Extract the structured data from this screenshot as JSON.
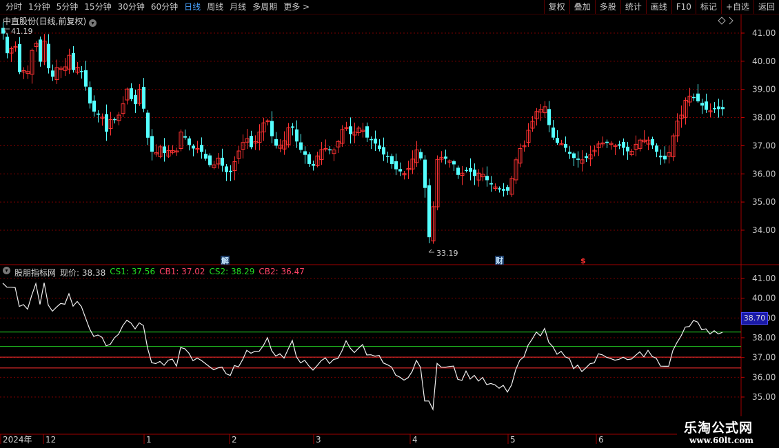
{
  "toolbar": {
    "periods": [
      "分时",
      "1分钟",
      "5分钟",
      "15分钟",
      "30分钟",
      "60分钟",
      "日线",
      "周线",
      "月线",
      "多周期",
      "更多 >"
    ],
    "active_period": "日线",
    "right_buttons": [
      "复权",
      "叠加",
      "多股",
      "统计",
      "画线",
      "F10",
      "标记",
      "+自选",
      "返回"
    ]
  },
  "main": {
    "title": "中直股份(日线,前复权)",
    "axis_ticks": [
      "41.00",
      "40.00",
      "39.00",
      "38.00",
      "37.00",
      "36.00",
      "35.00",
      "34.00"
    ],
    "high_label": "41.19",
    "low_label": "33.19",
    "markers": [
      "解",
      "财",
      "$"
    ]
  },
  "indicator": {
    "name": "股朋指标网",
    "values": [
      {
        "label": "现价: 38.38",
        "color": "#d0d0d0"
      },
      {
        "label": "CS1: 37.56",
        "color": "#22dd22"
      },
      {
        "label": "CB1: 37.02",
        "color": "#ff4466"
      },
      {
        "label": "CS2: 38.29",
        "color": "#22dd22"
      },
      {
        "label": "CB2: 36.47",
        "color": "#ff4466"
      }
    ],
    "axis_ticks": [
      "41.00",
      "40.00",
      "39.00",
      "38.00",
      "37.00",
      "36.00",
      "35.00"
    ],
    "current_badge": "38.70"
  },
  "xaxis": {
    "labels": [
      "2024年",
      "12",
      "1",
      "2",
      "3",
      "4",
      "5",
      "6"
    ]
  },
  "watermark": {
    "line1": "乐淘公式网",
    "line2": "www.60lt.com"
  },
  "colors": {
    "up": "#ff3232",
    "down": "#54ffff",
    "grid": "#7a0000",
    "green_line": "#22cc22",
    "red_line": "#ff3030"
  }
}
